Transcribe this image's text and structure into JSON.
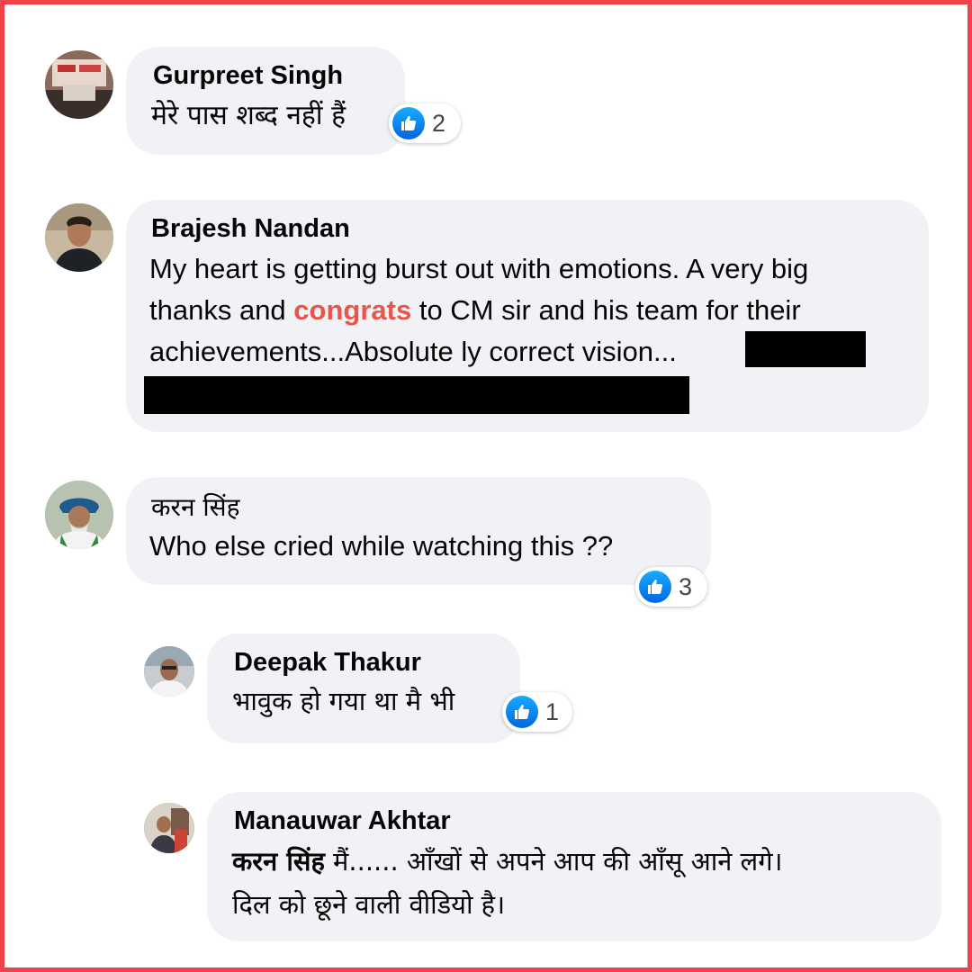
{
  "comments": [
    {
      "author": "Gurpreet Singh",
      "text": "मेरे पास शब्द नहीं हैं",
      "reaction": {
        "icon": "like-icon",
        "count": "2"
      }
    },
    {
      "author": "Brajesh Nandan",
      "text_line1": "My heart is getting burst out with emotions. A very big",
      "text_line2_pre": "thanks and ",
      "text_line2_highlight": "congrats",
      "text_line2_post": " to CM sir and his team for their",
      "text_line3": "achievements...Absolute ly correct vision..."
    },
    {
      "author": "करन सिंह",
      "text": "Who else cried while watching this ??",
      "reaction": {
        "icon": "like-icon",
        "count": "3"
      }
    },
    {
      "author": "Deepak Thakur",
      "text": "भावुक हो गया था मै भी",
      "reaction": {
        "icon": "like-icon",
        "count": "1"
      }
    },
    {
      "author": "Manauwar Akhtar",
      "mention": "करन सिंह",
      "text_line1_post": " मैं...... आँखों से अपने आप की आँसू आने लगे।",
      "text_line2": "दिल को छूने वाली वीडियो है।"
    }
  ],
  "colors": {
    "frame": "#f0444a",
    "bubble": "#f0f2f5",
    "highlight": "#e8564a",
    "like": "#0d6efd"
  }
}
